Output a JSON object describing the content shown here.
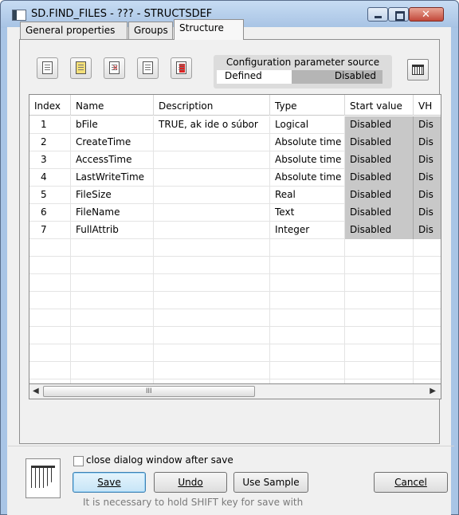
{
  "window": {
    "title": "SD.FIND_FILES - ??? - STRUCTSDEF"
  },
  "tabs": [
    {
      "label": "General properties"
    },
    {
      "label": "Groups"
    },
    {
      "label": "Structure"
    }
  ],
  "config": {
    "label": "Configuration parameter source",
    "defined": "Defined",
    "disabled": "Disabled"
  },
  "toolbar": {
    "icons": [
      "new-item-icon",
      "insert-item-icon",
      "delete-item-icon",
      "copy-item-icon",
      "paste-item-icon"
    ]
  },
  "grid": {
    "columns": [
      "Index",
      "Name",
      "Description",
      "Type",
      "Start value",
      "VH"
    ],
    "rows": [
      {
        "index": "1",
        "name": "bFile",
        "description": "TRUE, ak ide o súbor",
        "type": "Logical",
        "start": "Disabled",
        "vh": "Dis"
      },
      {
        "index": "2",
        "name": "CreateTime",
        "description": "",
        "type": "Absolute time",
        "start": "Disabled",
        "vh": "Dis"
      },
      {
        "index": "3",
        "name": "AccessTime",
        "description": "",
        "type": "Absolute time",
        "start": "Disabled",
        "vh": "Dis"
      },
      {
        "index": "4",
        "name": "LastWriteTime",
        "description": "",
        "type": "Absolute time",
        "start": "Disabled",
        "vh": "Dis"
      },
      {
        "index": "5",
        "name": "FileSize",
        "description": "",
        "type": "Real",
        "start": "Disabled",
        "vh": "Dis"
      },
      {
        "index": "6",
        "name": "FileName",
        "description": "",
        "type": "Text",
        "start": "Disabled",
        "vh": "Dis"
      },
      {
        "index": "7",
        "name": "FullAttrib",
        "description": "",
        "type": "Integer",
        "start": "Disabled",
        "vh": "Dis"
      }
    ],
    "scroll_grip": "III"
  },
  "footer": {
    "close_checkbox_label": "close dialog window after save",
    "close_checked": false,
    "save": "Save",
    "undo": "Undo",
    "use_sample": "Use Sample",
    "cancel": "Cancel",
    "hint": "It is necessary to hold SHIFT key for save with"
  }
}
